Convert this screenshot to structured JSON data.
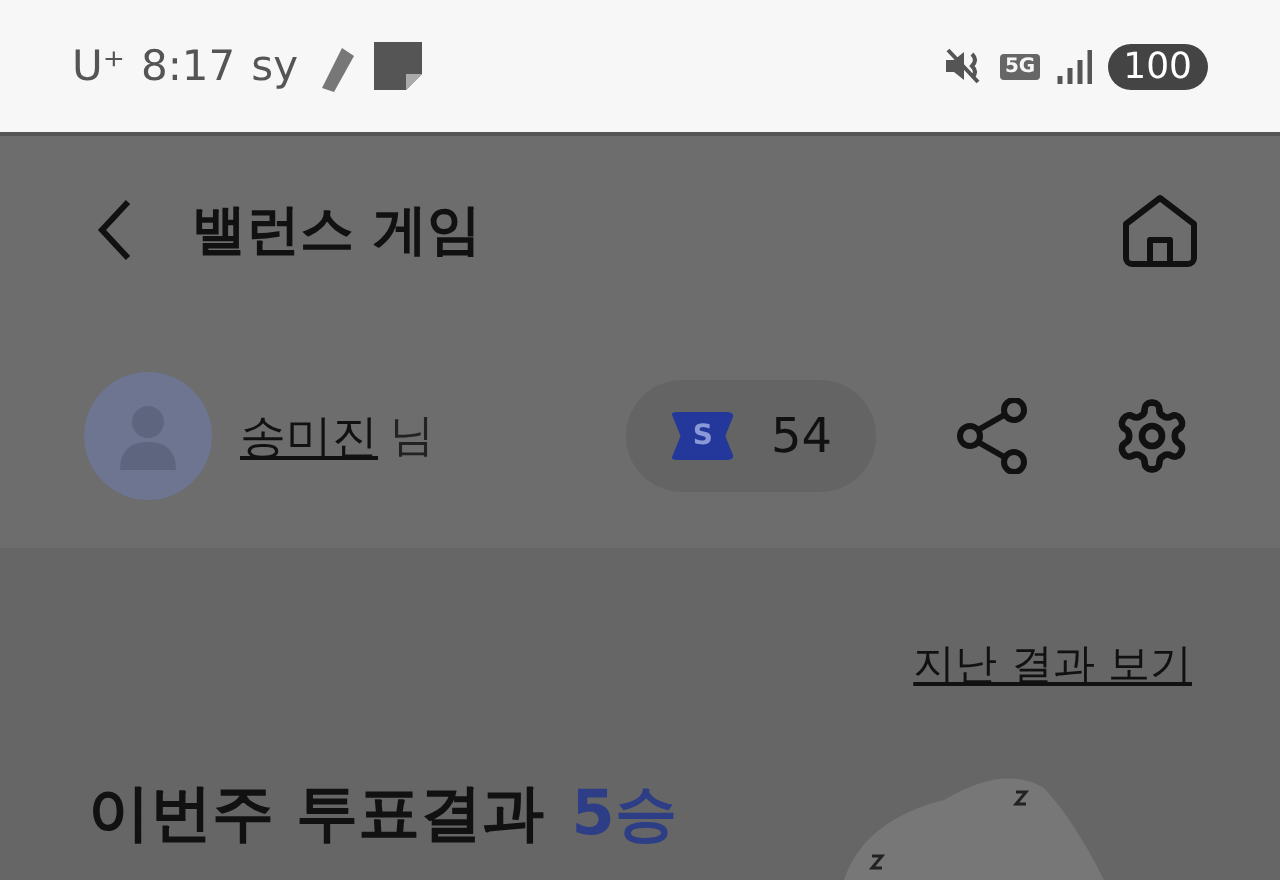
{
  "status_bar": {
    "carrier": "U⁺",
    "time": "8:17",
    "app_tag": "sy",
    "network": "5G",
    "battery": "100"
  },
  "header": {
    "title": "밸런스 게임"
  },
  "profile": {
    "name": "송미진",
    "suffix": "님",
    "ticket_letter": "S",
    "ticket_count": "54"
  },
  "past_results_link": "지난 결과 보기",
  "weekly": {
    "title": "이번주 투표결과",
    "wins": "5승"
  }
}
